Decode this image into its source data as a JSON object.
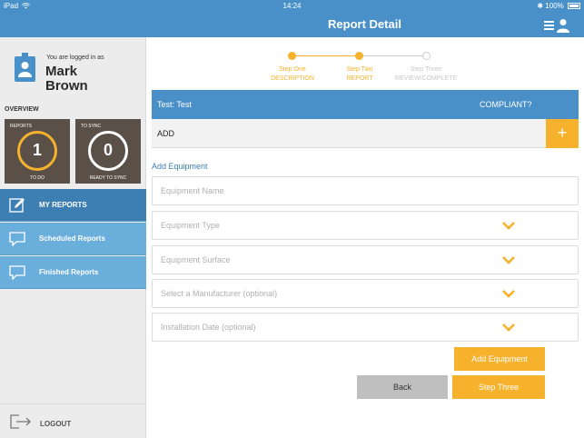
{
  "statusbar": {
    "device": "iPad",
    "time": "14:24",
    "battery": "100%"
  },
  "navbar": {
    "title": "Report Detail"
  },
  "user": {
    "logged_in_label": "You are logged in as",
    "first_name": "Mark",
    "last_name": "Brown"
  },
  "overview": {
    "label": "OVERVIEW",
    "tiles": [
      {
        "top_label": "REPORTS",
        "count": "1",
        "bottom_label": "TO DO",
        "ring_color": "#f6b22c"
      },
      {
        "top_label": "TO SYNC",
        "count": "0",
        "bottom_label": "READY TO SYNC",
        "ring_color": "#ffffff"
      }
    ]
  },
  "sidebar": {
    "items": [
      {
        "label": "MY REPORTS",
        "active": true
      },
      {
        "label": "Scheduled Reports",
        "active": false
      },
      {
        "label": "Finished Reports",
        "active": false
      }
    ],
    "logout_label": "LOGOUT"
  },
  "steps": [
    {
      "line1": "Step One",
      "line2": "DESCRIPTION",
      "state": "done"
    },
    {
      "line1": "Step Two",
      "line2": "REPORT",
      "state": "current"
    },
    {
      "line1": "Step Three",
      "line2": "REVIEW/COMPLETE",
      "state": "pending"
    }
  ],
  "test": {
    "label": "Test: Test",
    "compliant_label": "COMPLIANT?"
  },
  "add_row": {
    "label": "ADD",
    "plus": "+"
  },
  "form": {
    "section_title": "Add Equipment",
    "fields": [
      {
        "placeholder": "Equipment Name",
        "dropdown": false
      },
      {
        "placeholder": "Equipment Type",
        "dropdown": true
      },
      {
        "placeholder": "Equipment Surface",
        "dropdown": true
      },
      {
        "placeholder": "Select a Manufacturer (optional)",
        "dropdown": true
      },
      {
        "placeholder": "Installation Date (optional)",
        "dropdown": true
      }
    ],
    "add_equipment_label": "Add Equipment",
    "back_label": "Back",
    "step_three_label": "Step Three"
  },
  "colors": {
    "primary": "#4a90c8",
    "accent": "#f6b22c",
    "sidebar_active": "#3d7fb3",
    "sidebar_item": "#6aaedc",
    "tile_bg": "#5a5048"
  }
}
